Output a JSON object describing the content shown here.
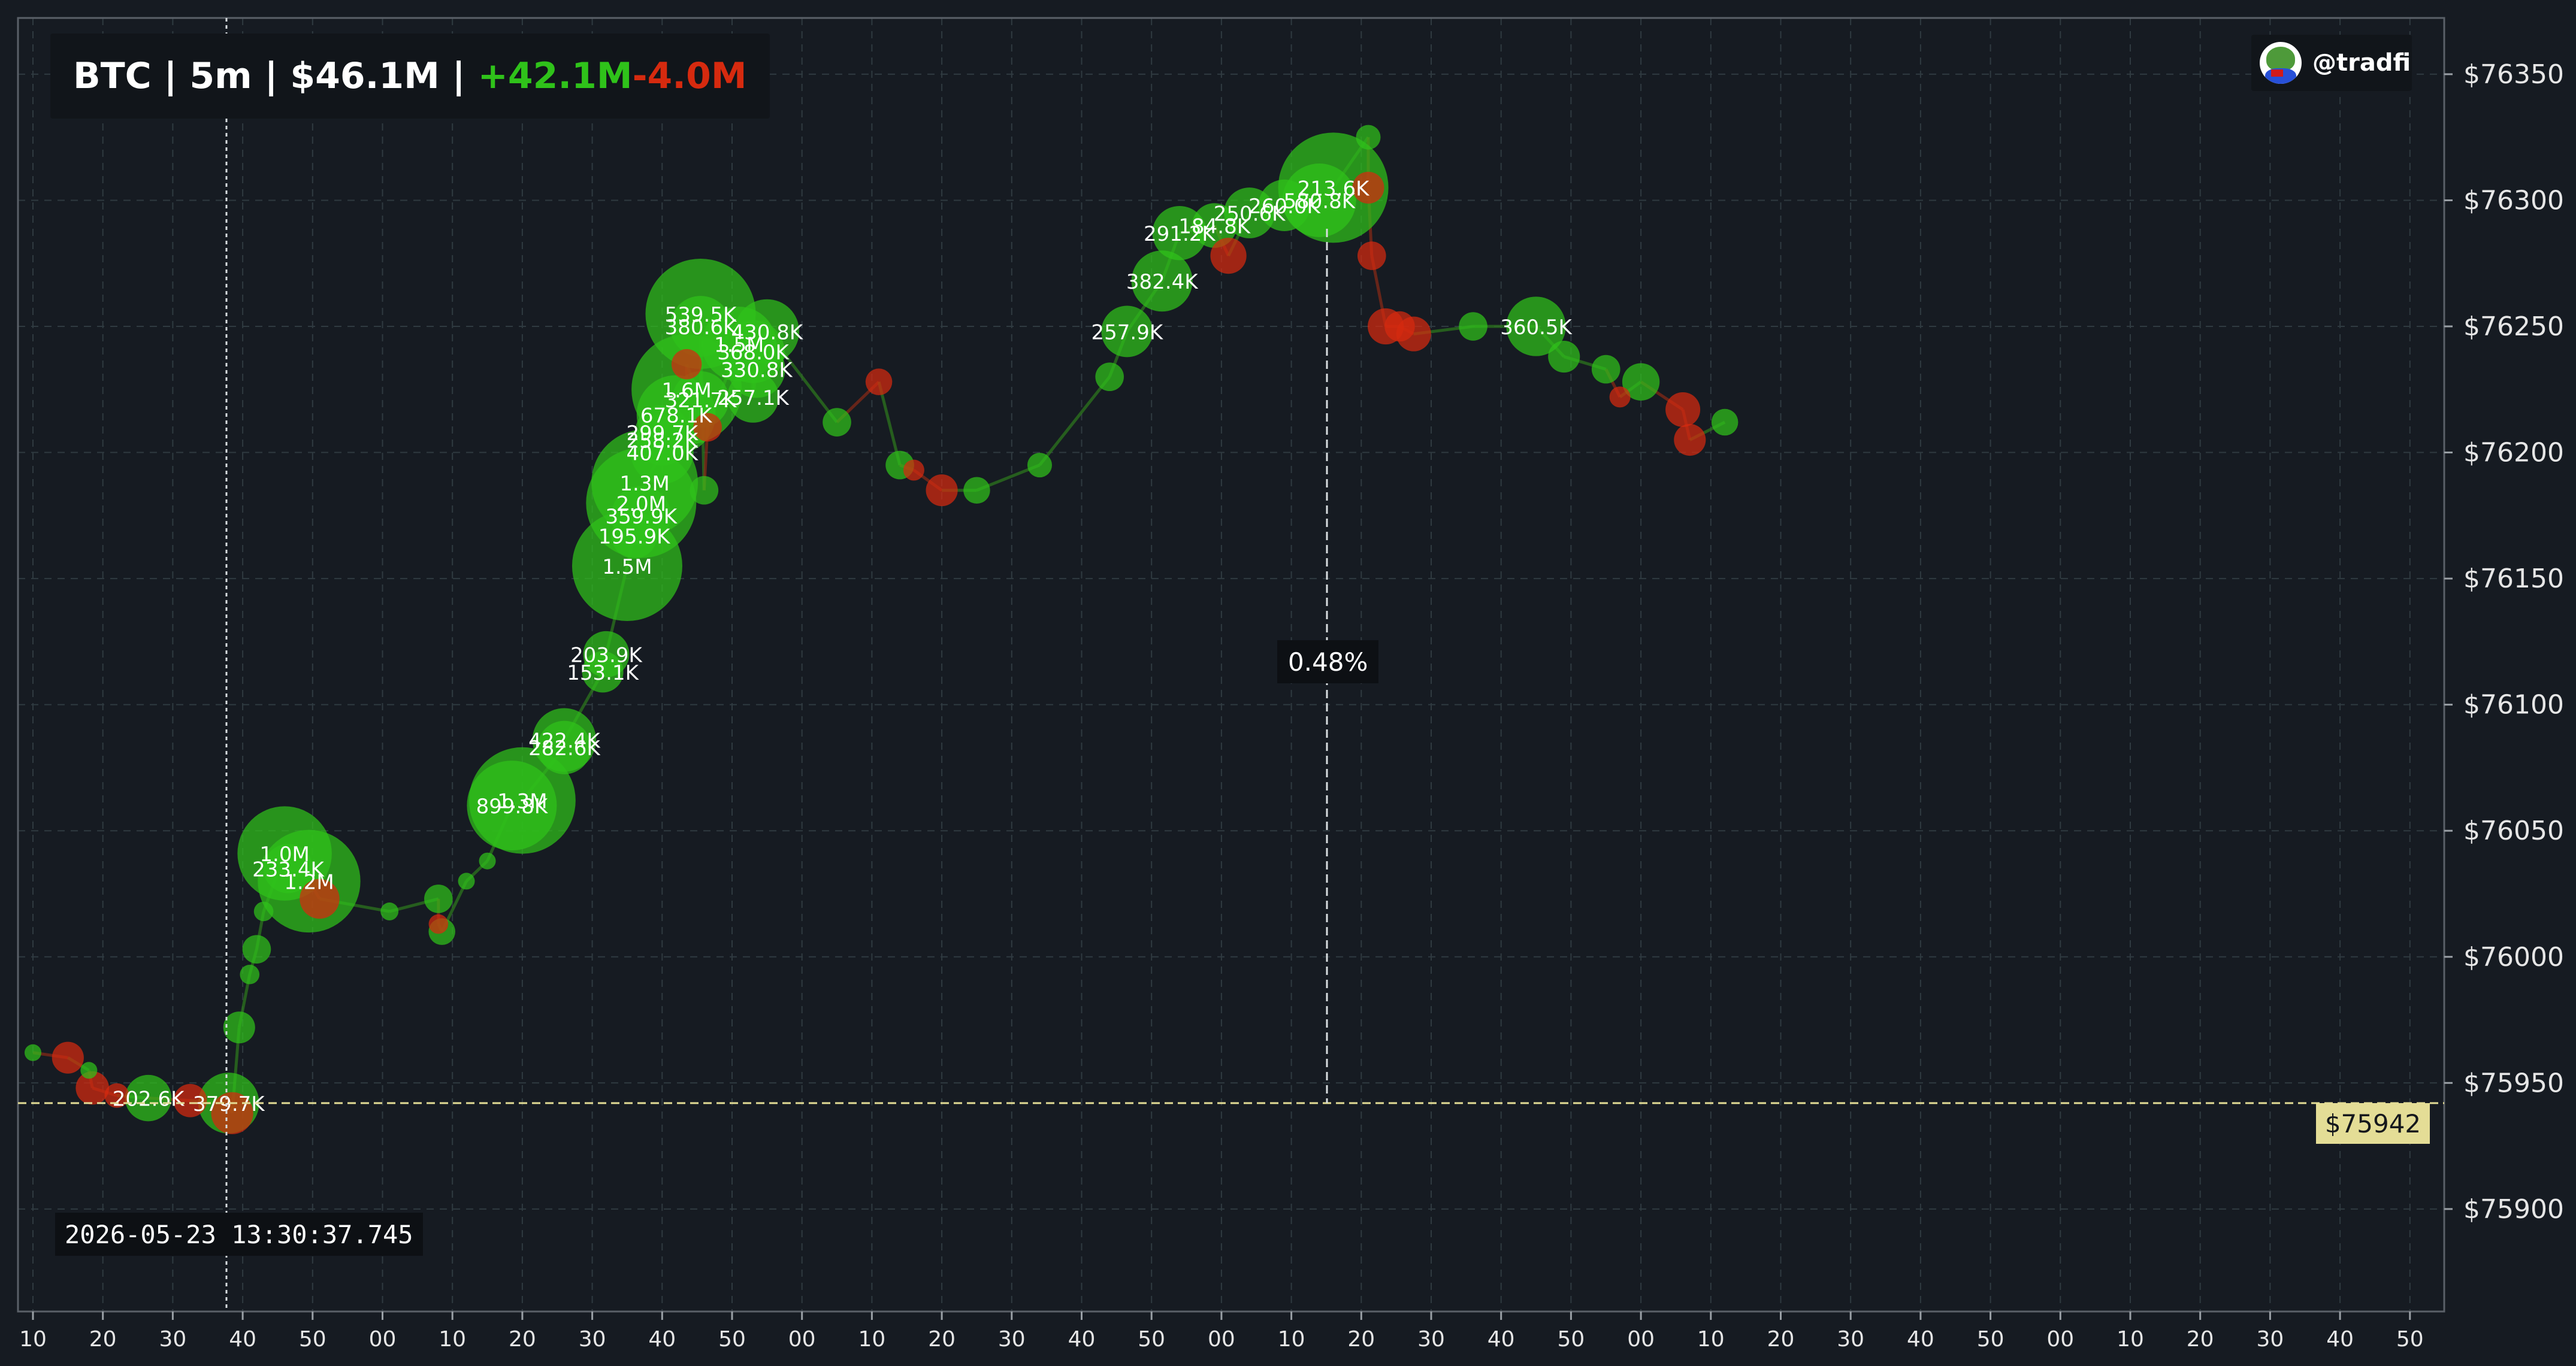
{
  "header": {
    "symbol": "BTC",
    "interval": "5m",
    "volume": "$46.1M",
    "buy_volume": "+42.1M",
    "sell_volume": "-4.0M",
    "separator": " | "
  },
  "brand": {
    "handle": "@tradfi",
    "avatar_icon": "pepe-avatar-icon"
  },
  "cursor": {
    "timestamp": "2026-05-23 13:30:37.745",
    "price_label": "$75942",
    "price": 75942,
    "percent_label": "0.48%"
  },
  "colors": {
    "background": "#161b22",
    "buy": "#2fc21a",
    "sell": "#d62a0f",
    "crosshair": "#e4dd96"
  },
  "chart_data": {
    "type": "scatter",
    "title": "",
    "xlabel": "",
    "ylabel": "",
    "ylim": [
      75870,
      76370
    ],
    "y_tick_values": [
      75900,
      75950,
      76000,
      76050,
      76100,
      76150,
      76200,
      76250,
      76300,
      76350
    ],
    "y_tick_labels": [
      "$75900",
      "$75950",
      "$76000",
      "$76050",
      "$76100",
      "$76150",
      "$76200",
      "$76250",
      "$76300",
      "$76350"
    ],
    "x_tick_labels": [
      "10",
      "20",
      "30",
      "40",
      "50",
      "00",
      "10",
      "20",
      "30",
      "40",
      "50",
      "00",
      "10",
      "20",
      "30",
      "40",
      "50",
      "00",
      "10",
      "20",
      "30",
      "40",
      "50",
      "00",
      "10",
      "20",
      "30",
      "40",
      "50",
      "00",
      "10",
      "20",
      "30",
      "40",
      "50"
    ],
    "x_unit": "seconds tick index (10-second steps)",
    "grid": true,
    "series": [
      {
        "name": "",
        "side": "buy",
        "points": [
          {
            "x": 0.0,
            "y": 75962,
            "size": 10
          },
          {
            "x": 0.8,
            "y": 75955,
            "size": 10
          },
          {
            "x": 1.65,
            "y": 75944,
            "size": 202.6,
            "label": "202.6K"
          },
          {
            "x": 2.8,
            "y": 75942,
            "size": 379.7,
            "label": "379.7K"
          },
          {
            "x": 2.95,
            "y": 75972,
            "size": 80
          },
          {
            "x": 3.1,
            "y": 75993,
            "size": 20
          },
          {
            "x": 3.2,
            "y": 76003,
            "size": 60
          },
          {
            "x": 3.3,
            "y": 76018,
            "size": 20
          },
          {
            "x": 3.6,
            "y": 76041,
            "size": 1000,
            "label": "1.0M"
          },
          {
            "x": 3.65,
            "y": 76035,
            "size": 233.4,
            "label": "233.4K"
          },
          {
            "x": 3.95,
            "y": 76030,
            "size": 1200,
            "label": "1.2M"
          },
          {
            "x": 5.1,
            "y": 76018,
            "size": 15
          },
          {
            "x": 5.8,
            "y": 76023,
            "size": 60
          },
          {
            "x": 5.85,
            "y": 76010,
            "size": 50
          },
          {
            "x": 6.2,
            "y": 76030,
            "size": 10
          },
          {
            "x": 6.5,
            "y": 76038,
            "size": 10
          },
          {
            "x": 6.85,
            "y": 76060,
            "size": 899.8,
            "label": "899.8K"
          },
          {
            "x": 7.0,
            "y": 76062,
            "size": 1300,
            "label": "1.3M"
          },
          {
            "x": 7.6,
            "y": 76083,
            "size": 282.6,
            "label": "282.6K"
          },
          {
            "x": 7.6,
            "y": 76086,
            "size": 420,
            "label": "422.4K"
          },
          {
            "x": 8.15,
            "y": 76113,
            "size": 153.1,
            "label": "153.1K"
          },
          {
            "x": 8.2,
            "y": 76120,
            "size": 200,
            "label": "203.9K"
          },
          {
            "x": 8.5,
            "y": 76155,
            "size": 1500,
            "label": "1.5M"
          },
          {
            "x": 8.6,
            "y": 76167,
            "size": 195.9,
            "label": "195.9K"
          },
          {
            "x": 8.7,
            "y": 76180,
            "size": 2000,
            "label": "2.0M"
          },
          {
            "x": 8.7,
            "y": 76175,
            "size": 359.9,
            "label": "359.9K"
          },
          {
            "x": 8.75,
            "y": 76188,
            "size": 1300,
            "label": "1.3M"
          },
          {
            "x": 9.0,
            "y": 76200,
            "size": 407.0,
            "label": "407.0K"
          },
          {
            "x": 9.0,
            "y": 76205,
            "size": 258.2,
            "label": "258.2K"
          },
          {
            "x": 9.0,
            "y": 76208,
            "size": 290,
            "label": "299.7K"
          },
          {
            "x": 9.2,
            "y": 76215,
            "size": 678.1,
            "label": "678.1K"
          },
          {
            "x": 9.35,
            "y": 76225,
            "size": 1600,
            "label": "1.6M"
          },
          {
            "x": 9.55,
            "y": 76221,
            "size": 321.7,
            "label": "321.7K"
          },
          {
            "x": 9.6,
            "y": 76185,
            "size": 60
          },
          {
            "x": 9.55,
            "y": 76255,
            "size": 1500,
            "label": "539.5K"
          },
          {
            "x": 9.55,
            "y": 76250,
            "size": 380.6,
            "label": "380.6K"
          },
          {
            "x": 10.1,
            "y": 76243,
            "size": 600,
            "label": "1.5M"
          },
          {
            "x": 10.3,
            "y": 76240,
            "size": 410,
            "label": "368.0K"
          },
          {
            "x": 10.35,
            "y": 76233,
            "size": 330,
            "label": "330.8K"
          },
          {
            "x": 10.3,
            "y": 76222,
            "size": 257.1,
            "label": "257.1K"
          },
          {
            "x": 10.5,
            "y": 76248,
            "size": 430.8,
            "label": "430.8K"
          },
          {
            "x": 11.5,
            "y": 76212,
            "size": 60
          },
          {
            "x": 12.4,
            "y": 76195,
            "size": 60
          },
          {
            "x": 13.5,
            "y": 76185,
            "size": 50
          },
          {
            "x": 14.4,
            "y": 76195,
            "size": 40
          },
          {
            "x": 15.4,
            "y": 76230,
            "size": 60
          },
          {
            "x": 15.65,
            "y": 76248,
            "size": 257.9,
            "label": "257.9K"
          },
          {
            "x": 16.15,
            "y": 76268,
            "size": 382.4,
            "label": "382.4K"
          },
          {
            "x": 16.4,
            "y": 76287,
            "size": 291.2,
            "label": "291.2K"
          },
          {
            "x": 16.9,
            "y": 76290,
            "size": 184.8,
            "label": "184.8K"
          },
          {
            "x": 17.4,
            "y": 76295,
            "size": 250,
            "label": "250.6K"
          },
          {
            "x": 17.9,
            "y": 76298,
            "size": 260,
            "label": "260.0K"
          },
          {
            "x": 18.4,
            "y": 76300,
            "size": 580.8,
            "label": "580.8K"
          },
          {
            "x": 18.6,
            "y": 76305,
            "size": 1500,
            "label": "213.6K"
          },
          {
            "x": 19.1,
            "y": 76325,
            "size": 40
          },
          {
            "x": 20.6,
            "y": 76250,
            "size": 60
          },
          {
            "x": 21.5,
            "y": 76250,
            "size": 360.5,
            "label": "360.5K"
          },
          {
            "x": 21.9,
            "y": 76238,
            "size": 80
          },
          {
            "x": 22.5,
            "y": 76233,
            "size": 60
          },
          {
            "x": 23.0,
            "y": 76228,
            "size": 120
          },
          {
            "x": 24.2,
            "y": 76212,
            "size": 50
          }
        ]
      },
      {
        "name": "",
        "side": "sell",
        "points": [
          {
            "x": 0.5,
            "y": 75960,
            "size": 80
          },
          {
            "x": 0.85,
            "y": 75948,
            "size": 90
          },
          {
            "x": 1.2,
            "y": 75945,
            "size": 40
          },
          {
            "x": 2.25,
            "y": 75943,
            "size": 90
          },
          {
            "x": 2.85,
            "y": 75938,
            "size": 160
          },
          {
            "x": 4.1,
            "y": 76023,
            "size": 140
          },
          {
            "x": 5.8,
            "y": 76013,
            "size": 20
          },
          {
            "x": 9.35,
            "y": 76235,
            "size": 70
          },
          {
            "x": 9.65,
            "y": 76210,
            "size": 60
          },
          {
            "x": 12.1,
            "y": 76228,
            "size": 50
          },
          {
            "x": 12.6,
            "y": 76193,
            "size": 25
          },
          {
            "x": 13.0,
            "y": 76185,
            "size": 80
          },
          {
            "x": 17.1,
            "y": 76278,
            "size": 110
          },
          {
            "x": 19.1,
            "y": 76305,
            "size": 80
          },
          {
            "x": 19.15,
            "y": 76278,
            "size": 60
          },
          {
            "x": 19.35,
            "y": 76250,
            "size": 110
          },
          {
            "x": 19.55,
            "y": 76250,
            "size": 70
          },
          {
            "x": 19.75,
            "y": 76247,
            "size": 100
          },
          {
            "x": 22.7,
            "y": 76222,
            "size": 25
          },
          {
            "x": 23.6,
            "y": 76217,
            "size": 100
          },
          {
            "x": 23.7,
            "y": 76205,
            "size": 80
          }
        ]
      }
    ]
  }
}
